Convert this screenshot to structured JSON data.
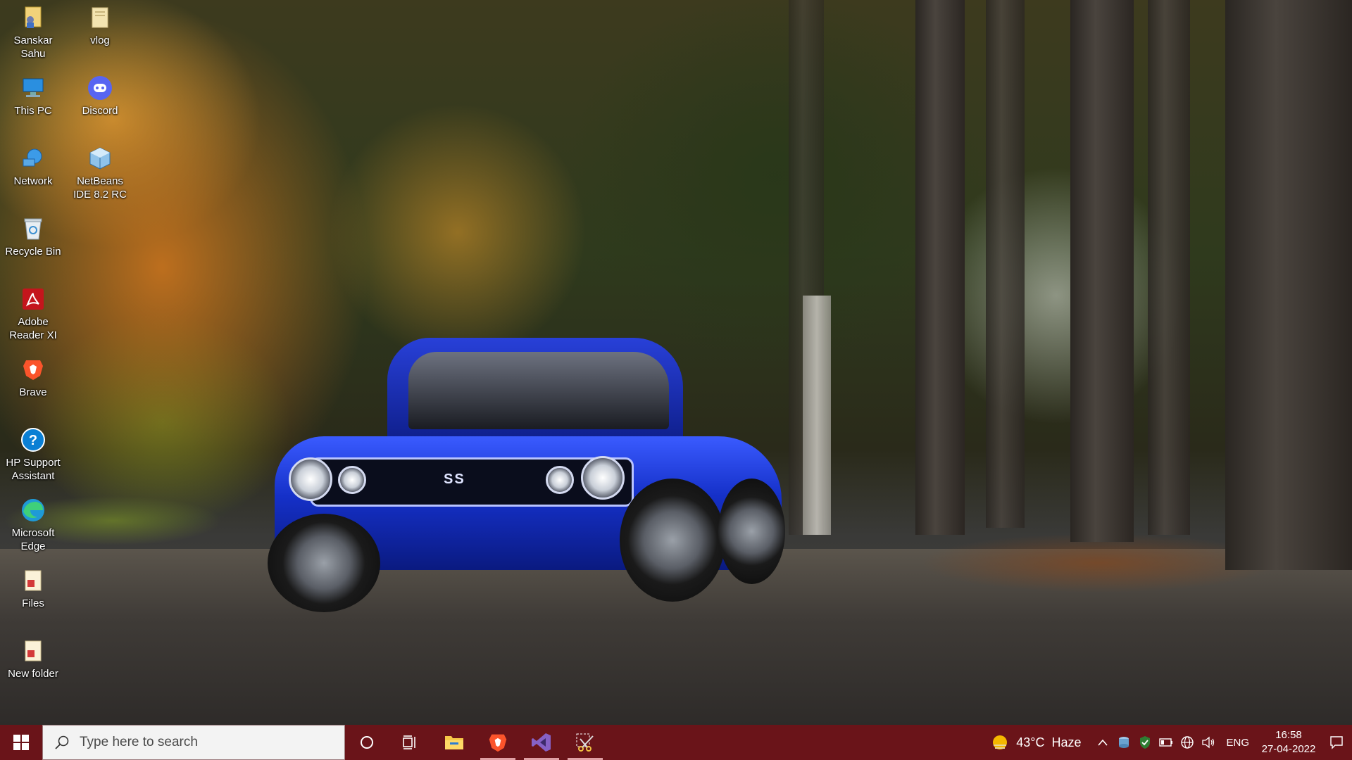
{
  "desktop": {
    "icons": [
      {
        "label": "Sanskar Sahu",
        "icon": "user-folder-icon"
      },
      {
        "label": "vlog",
        "icon": "folder-icon"
      },
      {
        "label": "This PC",
        "icon": "computer-icon"
      },
      {
        "label": "Discord",
        "icon": "discord-icon"
      },
      {
        "label": "Network",
        "icon": "network-icon"
      },
      {
        "label": "NetBeans IDE 8.2 RC",
        "icon": "netbeans-icon"
      },
      {
        "label": "Recycle Bin",
        "icon": "recycle-bin-icon"
      },
      {
        "label": "Adobe Reader XI",
        "icon": "adobe-reader-icon"
      },
      {
        "label": "Brave",
        "icon": "brave-icon"
      },
      {
        "label": "HP Support Assistant",
        "icon": "hp-support-icon"
      },
      {
        "label": "Microsoft Edge",
        "icon": "edge-icon"
      },
      {
        "label": "Files",
        "icon": "file-icon"
      },
      {
        "label": "New folder",
        "icon": "file-icon"
      }
    ],
    "wallpaper": {
      "car_badge": "SS"
    }
  },
  "taskbar": {
    "color": "#6a1419",
    "search_placeholder": "Type here to search",
    "pinned": [
      {
        "name": "cortana",
        "icon": "cortana-icon"
      },
      {
        "name": "task-view",
        "icon": "task-view-icon"
      },
      {
        "name": "file-explorer",
        "icon": "file-explorer-icon"
      },
      {
        "name": "brave",
        "icon": "brave-icon"
      },
      {
        "name": "visual-studio",
        "icon": "visual-studio-icon"
      },
      {
        "name": "snipping-tool",
        "icon": "snipping-tool-icon"
      }
    ],
    "weather": {
      "temperature": "43°C",
      "condition": "Haze"
    },
    "language": "ENG",
    "clock": {
      "time": "16:58",
      "date": "27-04-2022"
    }
  }
}
